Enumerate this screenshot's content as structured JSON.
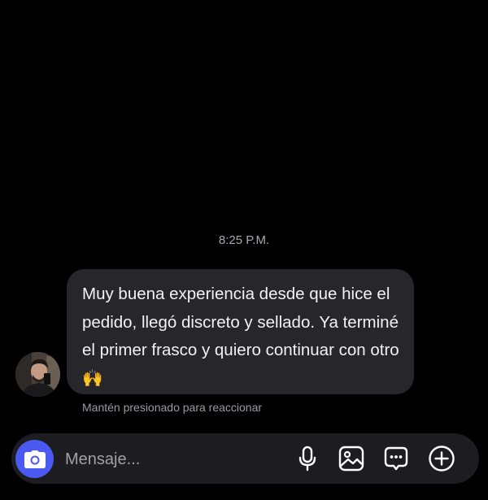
{
  "chat": {
    "timestamp": "8:25 P.M.",
    "message": {
      "text": "Muy buena experiencia desde que hice el pedido, llegó discreto y sellado. Ya terminé el primer frasco y quiero continuar con otro",
      "emoji": "🙌"
    },
    "hint": "Mantén presionado para reaccionar"
  },
  "composer": {
    "placeholder": "Mensaje...",
    "icons": [
      "camera-icon",
      "microphone-icon",
      "image-icon",
      "sticker-icon",
      "add-icon"
    ],
    "accent_color": "#4a5af0"
  }
}
